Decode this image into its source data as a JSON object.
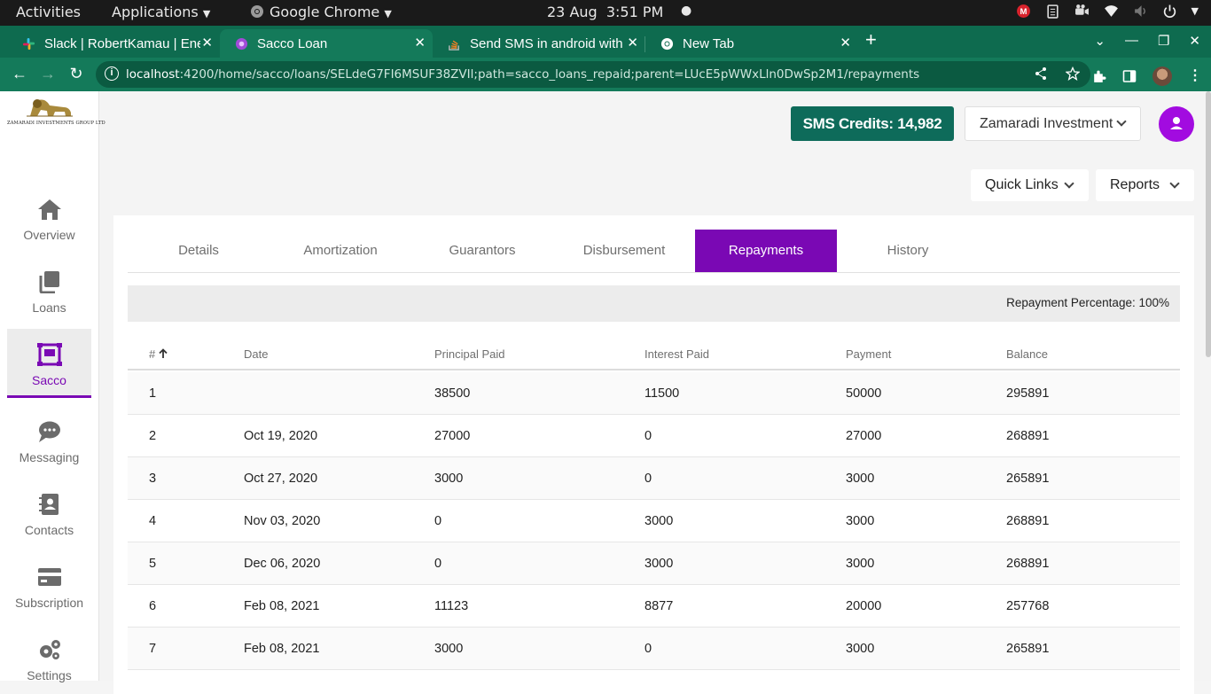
{
  "os": {
    "activities": "Activities",
    "applications": "Applications",
    "app_name": "Google Chrome",
    "date": "23 Aug",
    "time": "3:51 PM"
  },
  "browser": {
    "tabs": [
      {
        "title": "Slack | RobertKamau | Ene",
        "icon": "slack-icon"
      },
      {
        "title": "Sacco Loan",
        "icon": "sacco-icon",
        "active": true
      },
      {
        "title": "Send SMS in android with",
        "icon": "stackoverflow-icon"
      },
      {
        "title": "New Tab",
        "icon": "chrome-icon"
      }
    ],
    "url_host": "localhost",
    "url_path": ":4200/home/sacco/loans/SELdeG7FI6MSUF38ZVIl;path=sacco_loans_repaid;parent=LUcE5pWWxLln0DwSp2M1/repayments"
  },
  "sidebar": {
    "logo_text": "ZAMARADI INVESTMENTS GROUP LTD",
    "items": [
      {
        "label": "Overview",
        "icon": "home-icon"
      },
      {
        "label": "Loans",
        "icon": "copy-icon"
      },
      {
        "label": "Sacco",
        "icon": "sacco-icon",
        "active": true
      },
      {
        "label": "Messaging",
        "icon": "chat-icon"
      },
      {
        "label": "Contacts",
        "icon": "contact-card-icon"
      },
      {
        "label": "Subscription",
        "icon": "credit-card-icon"
      },
      {
        "label": "Settings",
        "icon": "gears-icon"
      }
    ]
  },
  "header": {
    "sms_credits": "SMS Credits: 14,982",
    "organization": "Zamaradi Investment",
    "quick_links": "Quick Links",
    "reports": "Reports"
  },
  "colors": {
    "brand_green": "#0e6b5a",
    "accent_purple": "#7a08b4",
    "avatar_purple": "#a20be0"
  },
  "loan_tabs": [
    "Details",
    "Amortization",
    "Guarantors",
    "Disbursement",
    "Repayments",
    "History"
  ],
  "active_tab": "Repayments",
  "repayment_percentage": "Repayment Percentage: 100%",
  "table": {
    "columns": [
      "#",
      "Date",
      "Principal Paid",
      "Interest Paid",
      "Payment",
      "Balance"
    ],
    "rows": [
      [
        "1",
        "",
        "38500",
        "11500",
        "50000",
        "295891"
      ],
      [
        "2",
        "Oct 19, 2020",
        "27000",
        "0",
        "27000",
        "268891"
      ],
      [
        "3",
        "Oct 27, 2020",
        "3000",
        "0",
        "3000",
        "265891"
      ],
      [
        "4",
        "Nov 03, 2020",
        "0",
        "3000",
        "3000",
        "268891"
      ],
      [
        "5",
        "Dec 06, 2020",
        "0",
        "3000",
        "3000",
        "268891"
      ],
      [
        "6",
        "Feb 08, 2021",
        "11123",
        "8877",
        "20000",
        "257768"
      ],
      [
        "7",
        "Feb 08, 2021",
        "3000",
        "0",
        "3000",
        "265891"
      ]
    ]
  }
}
